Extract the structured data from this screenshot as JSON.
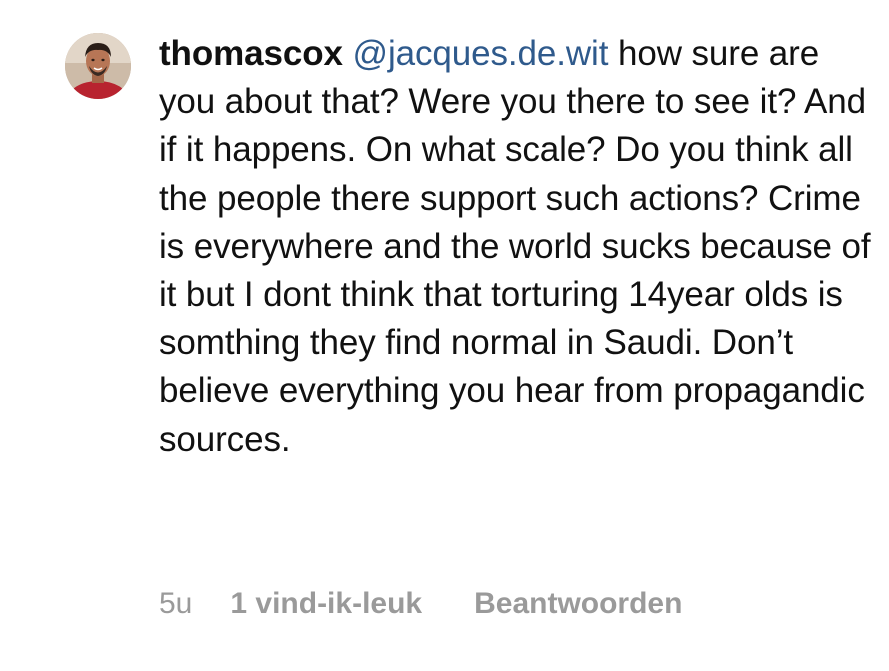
{
  "comment": {
    "username": "thomascox",
    "mention": "@jacques.de.wit",
    "text": " how sure are you about that? Were you there to see it? And if it happens. On what scale? Do you think all the people there support such actions? Crime is everywhere and the world sucks because of it but I dont think that torturing 14year olds is somthing they find normal in Saudi. Don’t believe everything you hear from propagandic sources.",
    "time": "5u",
    "likes": "1 vind-ik-leuk",
    "reply": "Beantwoorden"
  },
  "colors": {
    "text": "#111111",
    "mention": "#2f5a8c",
    "meta": "#9a9a9a"
  }
}
